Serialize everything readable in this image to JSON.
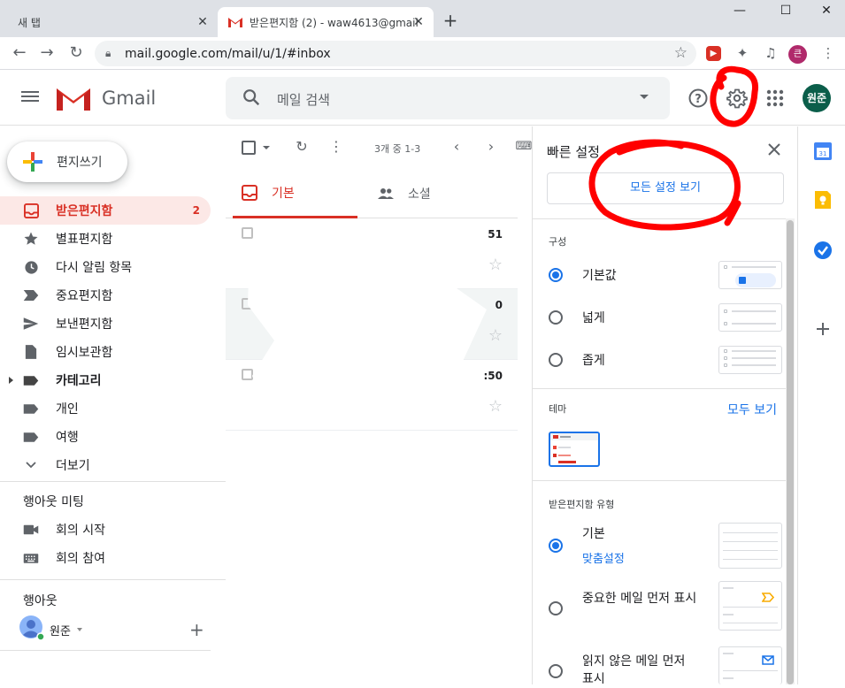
{
  "browser": {
    "tabs": [
      {
        "title": "새 탭"
      },
      {
        "title": "받은편지함 (2) - waw4613@gmail..."
      }
    ],
    "new_tab_label": "+",
    "url": "mail.google.com/mail/u/1/#inbox",
    "profile_initial": "큰",
    "window_buttons": {
      "minimize": "—",
      "maximize": "☐",
      "close": "✕"
    }
  },
  "header": {
    "app_name": "Gmail",
    "search_placeholder": "메일 검색",
    "avatar_initials": "원준"
  },
  "sidebar": {
    "compose_label": "편지쓰기",
    "items": [
      {
        "label": "받은편지함",
        "count": "2",
        "icon": "inbox-icon",
        "active": true
      },
      {
        "label": "별표편지함",
        "icon": "star-icon"
      },
      {
        "label": "다시 알림 항목",
        "icon": "clock-icon"
      },
      {
        "label": "중요편지함",
        "icon": "important-icon"
      },
      {
        "label": "보낸편지함",
        "icon": "send-icon"
      },
      {
        "label": "임시보관함",
        "icon": "draft-icon"
      },
      {
        "label": "카테고리",
        "icon": "label-icon",
        "bold": true
      },
      {
        "label": "개인",
        "icon": "label-icon"
      },
      {
        "label": "여행",
        "icon": "label-icon"
      },
      {
        "label": "더보기",
        "icon": "chevron-down-icon"
      }
    ],
    "meet": {
      "title": "행아웃 미팅",
      "items": [
        {
          "label": "회의 시작",
          "icon": "video-icon"
        },
        {
          "label": "회의 참여",
          "icon": "keyboard-icon"
        }
      ]
    },
    "hangouts": {
      "title": "행아웃",
      "user": "원준",
      "add": "+"
    }
  },
  "toolbar": {
    "range": "3개 중 1-3"
  },
  "inbox_tabs": [
    {
      "label": "기본",
      "icon": "inbox-icon"
    },
    {
      "label": "소셜",
      "icon": "people-icon"
    }
  ],
  "messages": [
    {
      "time": "51"
    },
    {
      "time": "0"
    },
    {
      "time": ":50"
    }
  ],
  "quick_settings": {
    "title": "빠른 설정",
    "all_settings_button": "모든 설정 보기",
    "density": {
      "section": "구성",
      "options": [
        {
          "label": "기본값",
          "selected": true
        },
        {
          "label": "넓게",
          "selected": false
        },
        {
          "label": "좁게",
          "selected": false
        }
      ]
    },
    "theme": {
      "section": "테마",
      "view_all": "모두 보기"
    },
    "inbox_type": {
      "section": "받은편지함 유형",
      "options": [
        {
          "label": "기본",
          "sublink": "맞춤설정",
          "selected": true
        },
        {
          "label": "중요한 메일 먼저 표시",
          "selected": false
        },
        {
          "label": "읽지 않은 메일 먼저 표시",
          "selected": false
        }
      ]
    }
  },
  "colors": {
    "gmail_red": "#d93025",
    "accent_blue": "#1a73e8",
    "annotation_red": "#ff0000",
    "avatar_green": "#0b5e4a"
  }
}
